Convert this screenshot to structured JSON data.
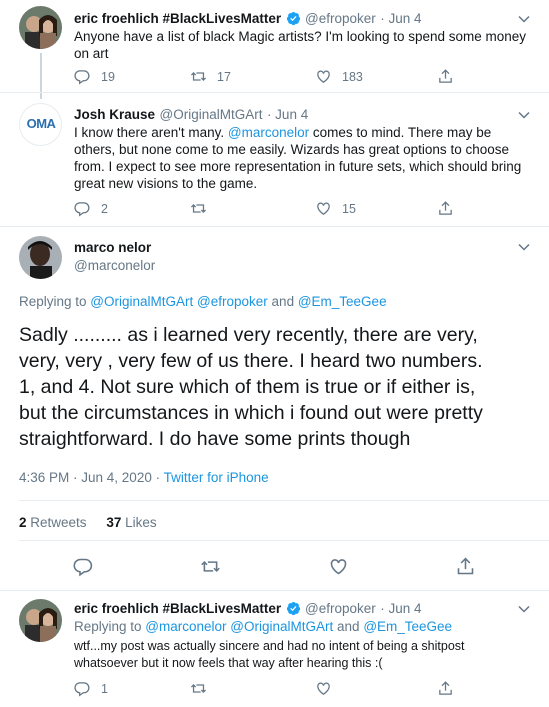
{
  "tweet1": {
    "name": "eric froehlich #BlackLivesMatter",
    "handle": "@efropoker",
    "date": "· Jun 4",
    "text_l1": "Anyone have a list of black Magic artists? I'm looking to spend some money",
    "text_l2": "on art",
    "replies": "19",
    "retweets": "17",
    "likes": "183"
  },
  "tweet2": {
    "name": "Josh Krause",
    "handle": "@OriginalMtGArt",
    "date": "· Jun 4",
    "logo": "OMA",
    "l1_pre": "I know there aren't many.  ",
    "l1_mention": "@marconelor",
    "l1_post": " comes to mind.  There may be",
    "l2": "others, but none come to me easily.  Wizards has great options to choose",
    "l3": "from.  I expect to see more representation in future sets, which should bring",
    "l4": "great new visions to the game.",
    "replies": "2",
    "likes": "15"
  },
  "main": {
    "name": "marco nelor",
    "handle": "@marconelor",
    "replying_prefix": "Replying to ",
    "replying_m1": "@OriginalMtGArt",
    "replying_m2": "@efropoker",
    "replying_and": " and ",
    "replying_m3": "@Em_TeeGee",
    "l1": "Sadly ......... as i learned very recently, there are very,",
    "l2": "very, very , very few of us there.  I heard two numbers.",
    "l3": "1, and 4. Not sure which of them is true or if either is,",
    "l4": "but the circumstances in which i found out were pretty",
    "l5": "straightforward. I do have some prints though",
    "timestamp": "4:36 PM · Jun 4, 2020 · ",
    "source": "Twitter for iPhone",
    "retweets_count": "2",
    "retweets_label": "Retweets",
    "likes_count": "37",
    "likes_label": "Likes"
  },
  "tweet4": {
    "name": "eric froehlich #BlackLivesMatter",
    "handle": "@efropoker",
    "date": "· Jun 4",
    "replying_prefix": "Replying to ",
    "replying_m1": "@marconelor",
    "replying_m2": "@OriginalMtGArt",
    "replying_and": " and ",
    "replying_m3": "@Em_TeeGee",
    "text_l1": "wtf...my post was actually sincere and had no intent of being a shitpost",
    "text_l2": "whatsoever but it now feels that way after hearing this :(",
    "replies": "1"
  },
  "colors": {
    "accent": "#1b95e0",
    "muted": "#657786",
    "divider": "#e6ecf0"
  }
}
